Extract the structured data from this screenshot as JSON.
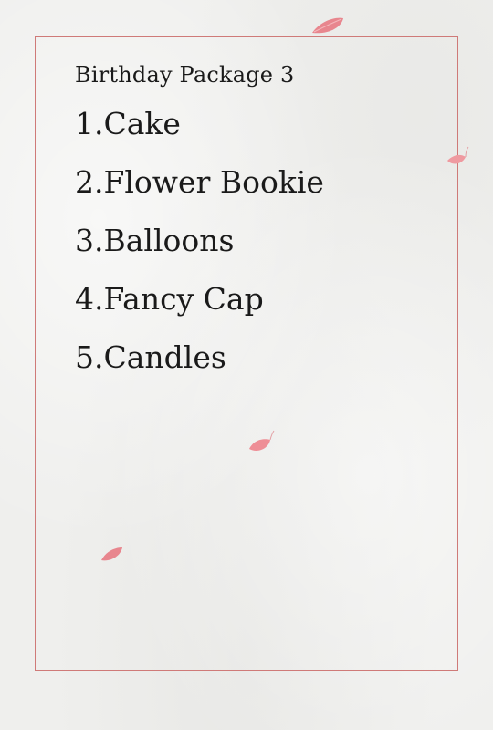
{
  "package": {
    "title": "Birthday Package 3",
    "items": [
      "1.Cake",
      "2.Flower Bookie",
      "3.Balloons",
      "4.Fancy Cap",
      "5.Candles"
    ]
  },
  "colors": {
    "frame_border": "#cf7a78",
    "petal": "#e8868e",
    "text": "#1a1a1a",
    "paper": "#efefed"
  }
}
